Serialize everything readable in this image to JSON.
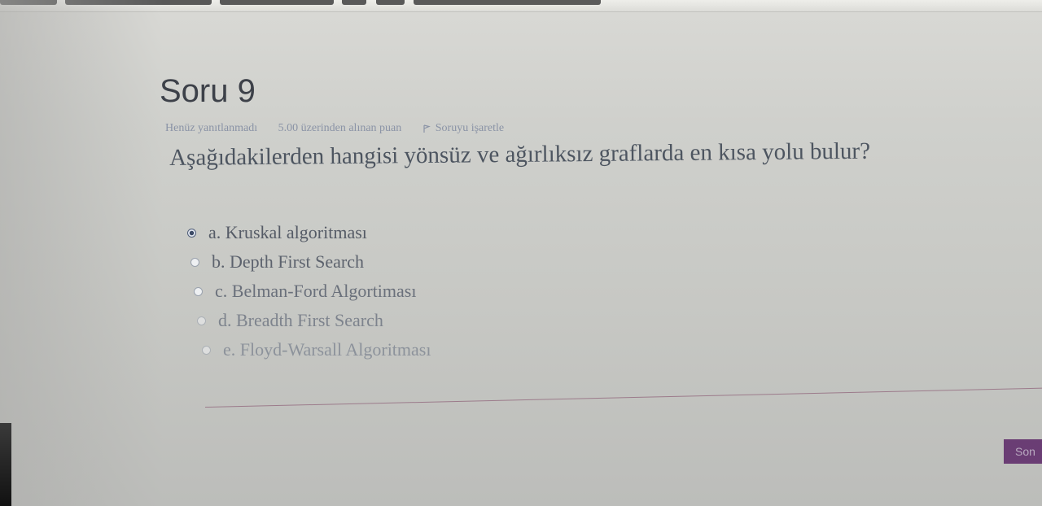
{
  "question": {
    "number_label": "Soru 9",
    "status": "Henüz yanıtlanmadı",
    "points": "5.00 üzerinden alınan puan",
    "flag_label": "Soruyu işaretle",
    "text": "Aşağıdakilerden hangisi yönsüz ve ağırlıksız graflarda en kısa yolu bulur?"
  },
  "answers": [
    {
      "label": "a. Kruskal algoritması",
      "selected": true
    },
    {
      "label": "b. Depth First Search",
      "selected": false
    },
    {
      "label": "c. Belman-Ford Algortiması",
      "selected": false
    },
    {
      "label": "d. Breadth First Search",
      "selected": false
    },
    {
      "label": "e. Floyd-Warsall Algoritması",
      "selected": false
    }
  ],
  "navigation": {
    "next_label": "Son"
  },
  "colors": {
    "accent": "#6a3d74",
    "meta_text": "#8a93a6"
  },
  "icons": {
    "flag": "flag-icon",
    "radio_selected": "radio-selected-icon",
    "radio_empty": "radio-empty-icon"
  }
}
